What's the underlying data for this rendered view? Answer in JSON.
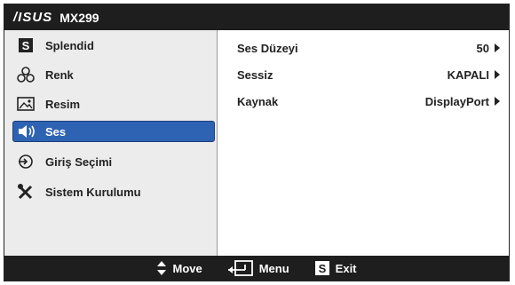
{
  "header": {
    "brand": "/ISUS",
    "model": "MX299"
  },
  "sidebar": {
    "items": [
      {
        "label": "Splendid",
        "icon": "splendid-s-icon"
      },
      {
        "label": "Renk",
        "icon": "color-balls-icon"
      },
      {
        "label": "Resim",
        "icon": "picture-icon"
      },
      {
        "label": "Ses",
        "icon": "speaker-icon",
        "active": true
      },
      {
        "label": "Giriş Seçimi",
        "icon": "input-arrow-icon"
      },
      {
        "label": "Sistem Kurulumu",
        "icon": "tools-icon"
      }
    ]
  },
  "content": {
    "rows": [
      {
        "name": "Ses Düzeyi",
        "value": "50"
      },
      {
        "name": "Sessiz",
        "value": "KAPALI"
      },
      {
        "name": "Kaynak",
        "value": "DisplayPort"
      }
    ]
  },
  "footer": {
    "move": "Move",
    "menu": "Menu",
    "exit": "Exit",
    "exit_glyph": "S"
  },
  "colors": {
    "bar": "#1e1e1e",
    "sidebar": "#ececec",
    "active": "#2e63b3"
  }
}
